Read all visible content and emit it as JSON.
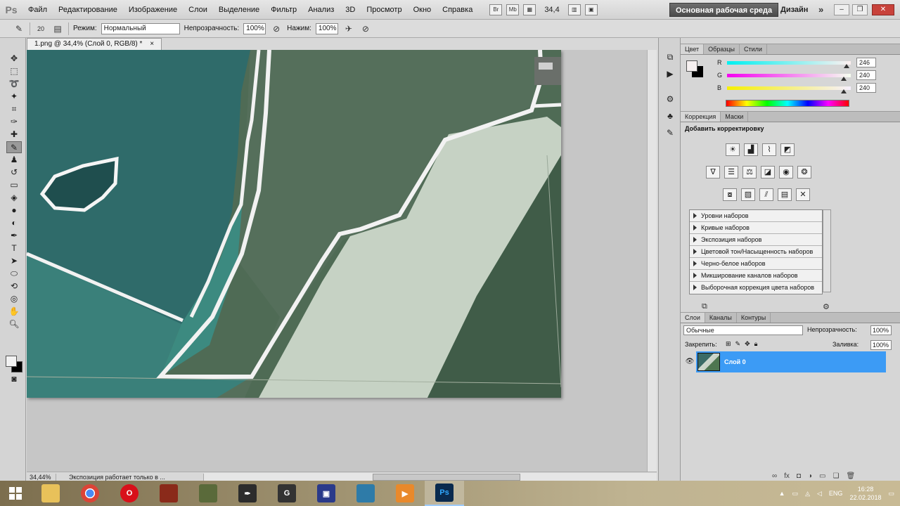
{
  "app": {
    "logo": "Ps"
  },
  "menu": [
    "Файл",
    "Редактирование",
    "Изображение",
    "Слои",
    "Выделение",
    "Фильтр",
    "Анализ",
    "3D",
    "Просмотр",
    "Окно",
    "Справка"
  ],
  "menubar_tools": {
    "br": "Br",
    "mb": "Mb",
    "zoom": "34,4"
  },
  "workspace": {
    "active": "Основная рабочая среда",
    "design": "Дизайн",
    "more": "»"
  },
  "options": {
    "brush_size": "20",
    "mode_label": "Режим:",
    "mode_value": "Нормальный",
    "opacity_label": "Непрозрачность:",
    "opacity_value": "100%",
    "flow_label": "Нажим:",
    "flow_value": "100%"
  },
  "document": {
    "tab_title": "1.png @ 34,4% (Слой 0, RGB/8) *",
    "close": "×"
  },
  "status": {
    "zoom": "34,44%",
    "info": "Экспозиция работает только в ..."
  },
  "color_panel": {
    "tabs": [
      "Цвет",
      "Образцы",
      "Стили"
    ],
    "channels": [
      {
        "name": "R",
        "value": "246",
        "level": 246,
        "gradient": "linear-gradient(to right,#00f0f0,#fff0f0)"
      },
      {
        "name": "G",
        "value": "240",
        "level": 240,
        "gradient": "linear-gradient(to right,#f600f0,#f6fff0)"
      },
      {
        "name": "B",
        "value": "240",
        "level": 240,
        "gradient": "linear-gradient(to right,#f6f000,#f6f0ff)"
      }
    ]
  },
  "adjustments": {
    "tabs": [
      "Коррекция",
      "Маски"
    ],
    "heading": "Добавить корректировку",
    "presets": [
      "Уровни наборов",
      "Кривые наборов",
      "Экспозиция наборов",
      "Цветовой тон/Насыщенность наборов",
      "Черно-белое наборов",
      "Микширование каналов наборов",
      "Выборочная коррекция цвета наборов"
    ]
  },
  "layers": {
    "tabs": [
      "Слои",
      "Каналы",
      "Контуры"
    ],
    "blend_mode": "Обычные",
    "opacity_label": "Непрозрачность:",
    "opacity_value": "100%",
    "lock_label": "Закрепить:",
    "fill_label": "Заливка:",
    "fill_value": "100%",
    "layer_name": "Слой 0"
  },
  "taskbar": {
    "apps": [
      "explorer",
      "chrome",
      "opera",
      "game1",
      "game2",
      "inkscape",
      "gimp",
      "save",
      "folder",
      "media",
      "photoshop"
    ],
    "lang": "ENG",
    "time": "16:28",
    "date": "22.02.2018"
  }
}
